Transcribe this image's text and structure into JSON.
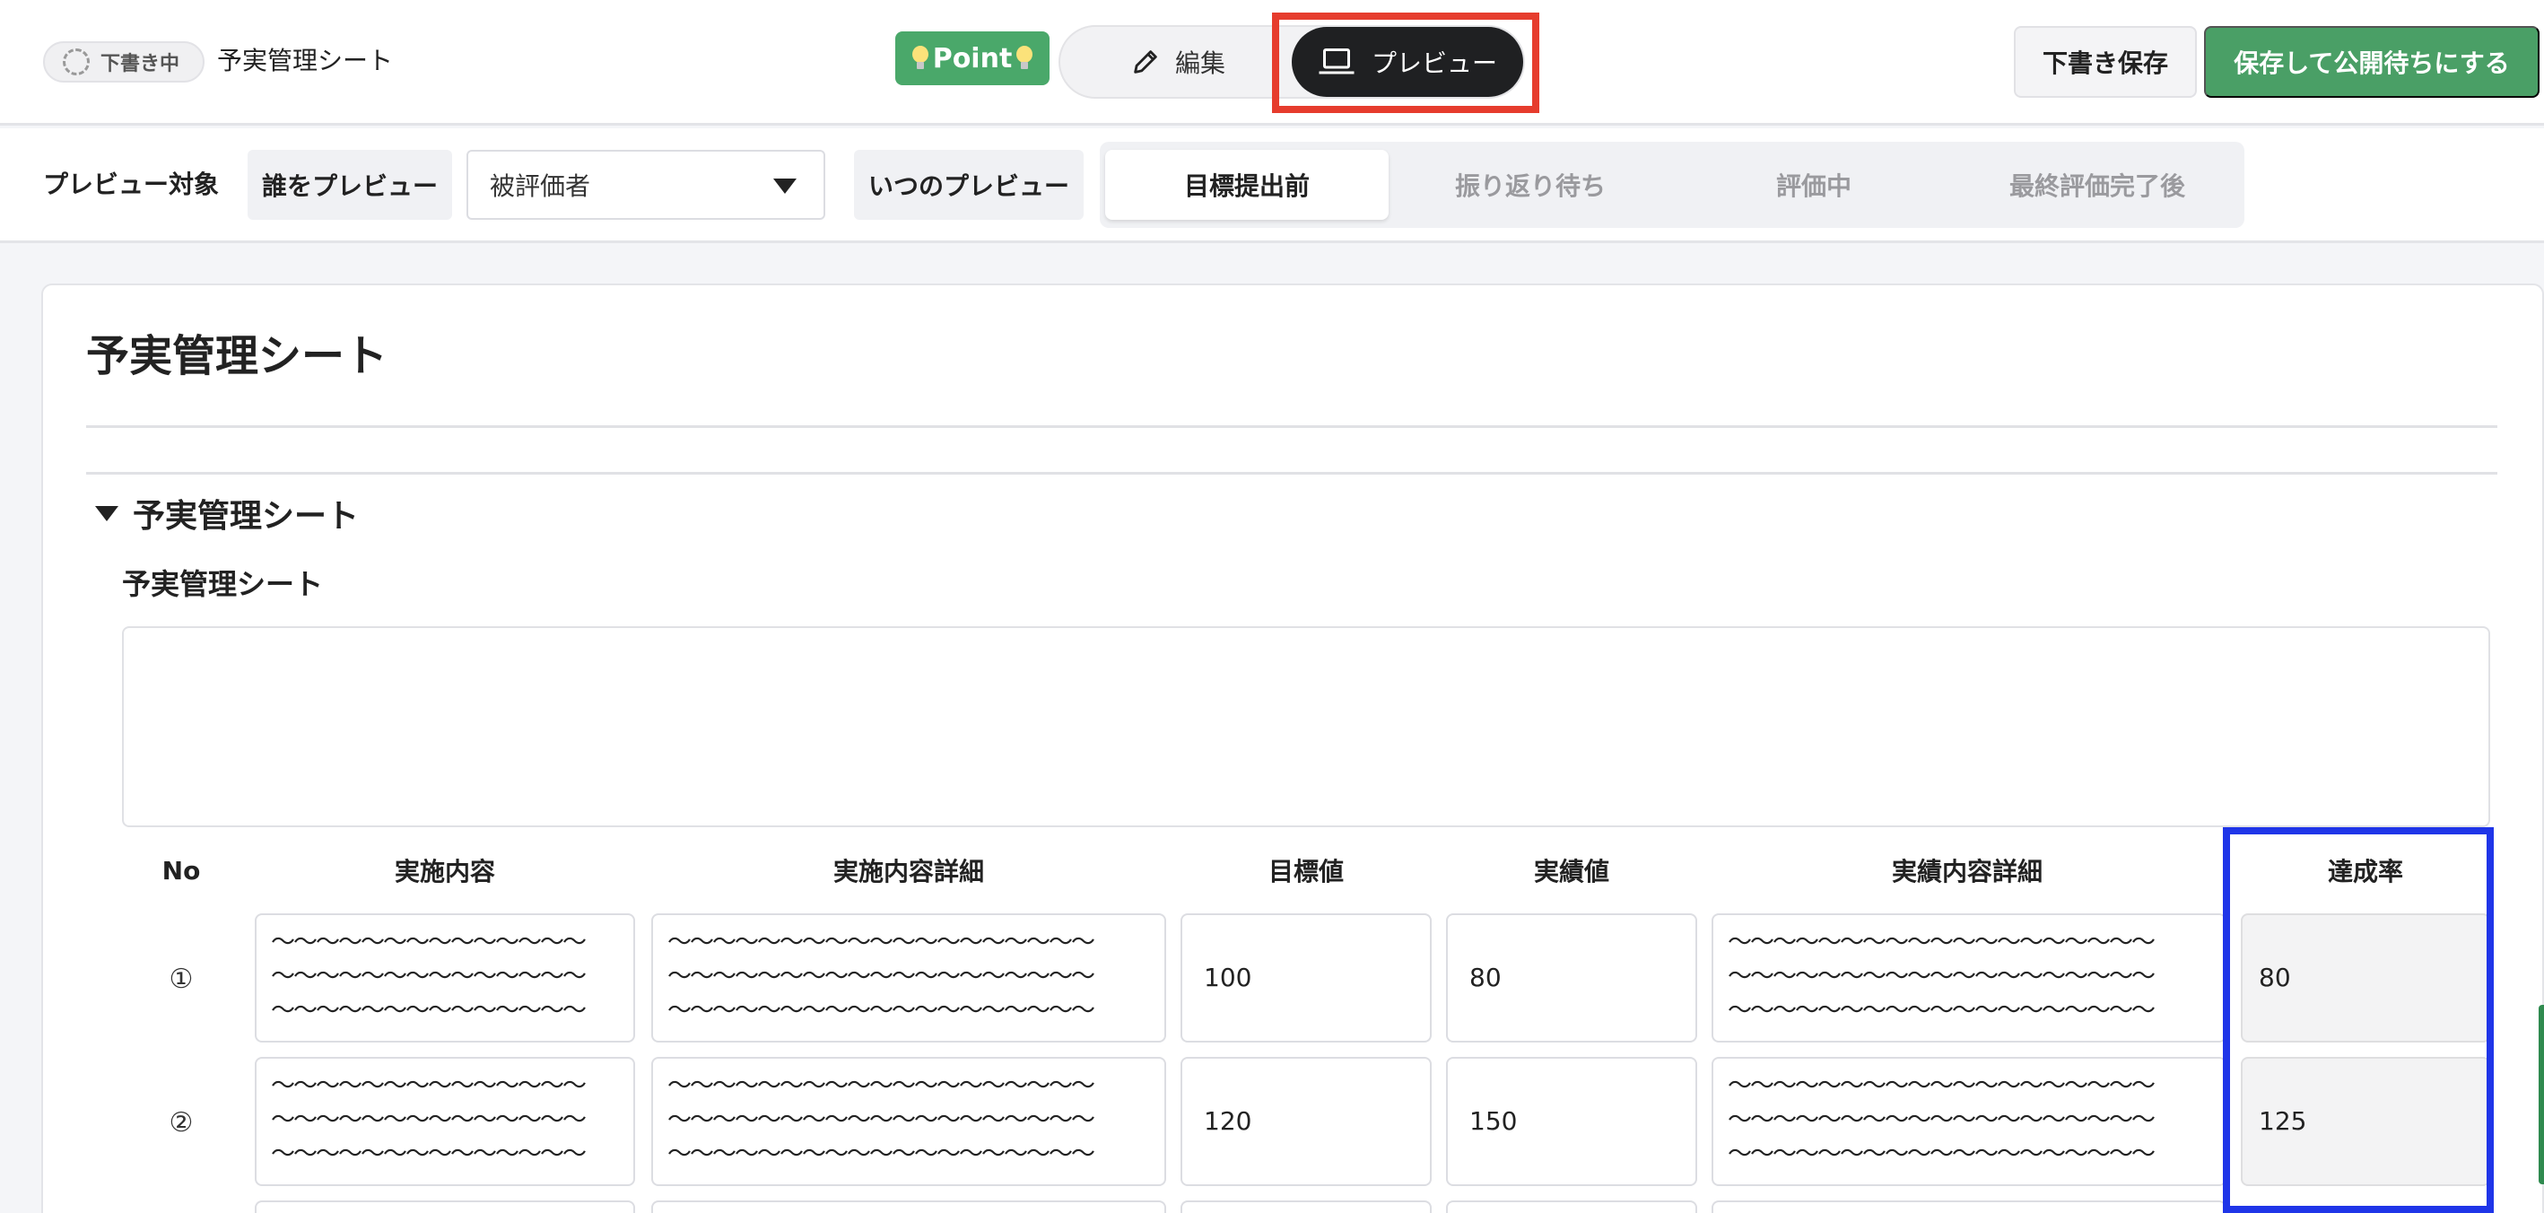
{
  "header": {
    "status": "下書き中",
    "title": "予実管理シート",
    "point_label": "Point",
    "mode_edit": "編集",
    "mode_preview": "プレビュー",
    "save_draft": "下書き保存",
    "publish": "保存して公開待ちにする"
  },
  "preview_bar": {
    "label": "プレビュー対象",
    "who_label": "誰をプレビュー",
    "who_value": "被評価者",
    "when_label": "いつのプレビュー",
    "phases": [
      "目標提出前",
      "振り返り待ち",
      "評価中",
      "最終評価完了後"
    ],
    "active_phase": "目標提出前"
  },
  "sheet": {
    "title": "予実管理シート",
    "section_title": "予実管理シート",
    "field_title": "予実管理シート",
    "columns": [
      "No",
      "実施内容",
      "実施内容詳細",
      "目標値",
      "実績値",
      "実績内容詳細",
      "達成率"
    ],
    "rows": [
      {
        "no": "①",
        "content": "〜〜〜〜〜〜〜〜〜〜〜〜〜〜\n〜〜〜〜〜〜〜〜〜〜〜〜〜〜\n〜〜〜〜〜〜〜〜〜〜〜〜〜〜",
        "content_detail": "〜〜〜〜〜〜〜〜〜〜〜〜〜〜〜〜〜〜〜\n〜〜〜〜〜〜〜〜〜〜〜〜〜〜〜〜〜〜〜\n〜〜〜〜〜〜〜〜〜〜〜〜〜〜〜〜〜〜〜",
        "target": "100",
        "actual": "80",
        "actual_detail": "〜〜〜〜〜〜〜〜〜〜〜〜〜〜〜〜〜〜〜\n〜〜〜〜〜〜〜〜〜〜〜〜〜〜〜〜〜〜〜\n〜〜〜〜〜〜〜〜〜〜〜〜〜〜〜〜〜〜〜",
        "rate": "80"
      },
      {
        "no": "②",
        "content": "〜〜〜〜〜〜〜〜〜〜〜〜〜〜\n〜〜〜〜〜〜〜〜〜〜〜〜〜〜\n〜〜〜〜〜〜〜〜〜〜〜〜〜〜",
        "content_detail": "〜〜〜〜〜〜〜〜〜〜〜〜〜〜〜〜〜〜〜\n〜〜〜〜〜〜〜〜〜〜〜〜〜〜〜〜〜〜〜\n〜〜〜〜〜〜〜〜〜〜〜〜〜〜〜〜〜〜〜",
        "target": "120",
        "actual": "150",
        "actual_detail": "〜〜〜〜〜〜〜〜〜〜〜〜〜〜〜〜〜〜〜\n〜〜〜〜〜〜〜〜〜〜〜〜〜〜〜〜〜〜〜\n〜〜〜〜〜〜〜〜〜〜〜〜〜〜〜〜〜〜〜",
        "rate": "125"
      }
    ]
  },
  "colors": {
    "accent_green": "#4a9f66",
    "highlight_red": "#e63c2d",
    "highlight_blue": "#1f35e8"
  },
  "icons": {
    "edit": "pencil-icon",
    "preview": "laptop-icon",
    "dropdown": "caret-down-icon",
    "section_toggle": "triangle-down-icon"
  }
}
